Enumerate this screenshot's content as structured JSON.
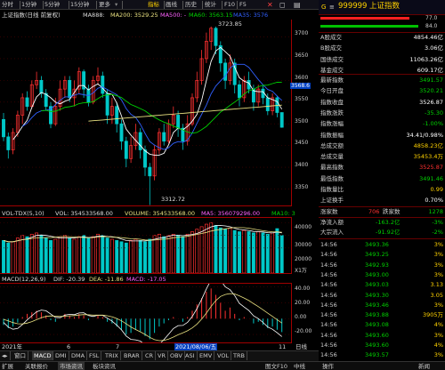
{
  "toolbar": {
    "items": [
      "分时",
      "1分钟",
      "5分钟",
      "15分钟",
      "更多",
      "指标",
      "画线",
      "历史",
      "统计",
      "F10",
      "F5"
    ],
    "selected_index": 5
  },
  "chart_header": {
    "title": "上证指数(日线 前复权)",
    "ma_label": "MA888:",
    "ma200": "MA200: 3529.25",
    "ma500": "MA500: -",
    "ma60": "MA60: 3563.15",
    "ma35": "MA35: 3576"
  },
  "price_axis": [
    "3700",
    "3650",
    "3600",
    "3550",
    "3500",
    "3450",
    "3400",
    "3350"
  ],
  "price_marker": "3568.6",
  "annot_high": "3723.85",
  "annot_low": "3312.72",
  "vol_header": {
    "name": "VOL-TDX(5,10)",
    "vol": "VOL: 354533568.00",
    "volume": "VOLUME: 354533568.00",
    "ma5": "MA5: 356079296.00",
    "ma10": "MA10: 3"
  },
  "vol_axis": [
    "40000",
    "30000",
    "20000"
  ],
  "vol_unit": "X1万",
  "macd_header": {
    "name": "MACD(12,26,9)",
    "dif": "DIF: -20.39",
    "dea": "DEA: -11.86",
    "macd": "MACD: -17.05"
  },
  "macd_axis": [
    "40.00",
    "20.00",
    "0.00",
    "-20.00"
  ],
  "date_axis": {
    "left": "2021年",
    "m6": "6",
    "m7": "7",
    "cursor_date": "2021/08/06/五",
    "m11": "11",
    "right": "日线"
  },
  "indicator_tabs": [
    "窗口",
    "MACD",
    "DMI",
    "DMA",
    "FSL",
    "TRIX",
    "BRAR",
    "CR",
    "VR",
    "OBV",
    "ASI",
    "EMV",
    "VOL",
    "TRB"
  ],
  "indicator_selected": 1,
  "bottom_bar": {
    "left_items": [
      "扩展",
      "关联报价",
      "市场资讯",
      "板块资讯"
    ],
    "right_items": [
      "图文F10",
      "中线",
      "操作",
      "新闻"
    ]
  },
  "quote_panel": {
    "code": "999999",
    "name": "上证指数",
    "mini_values": [
      "77.0",
      "84.0"
    ],
    "rows_a": [
      {
        "k": "A股成交",
        "v": "4854.46亿",
        "c": "white"
      },
      {
        "k": "B股成交",
        "v": "3.06亿",
        "c": "white"
      },
      {
        "k": "国债成交",
        "v": "11063.26亿",
        "c": "white"
      },
      {
        "k": "基金成交",
        "v": "609.17亿",
        "c": "white"
      }
    ],
    "rows_b": [
      {
        "k": "最新指数",
        "v": "3491.57",
        "c": "green"
      },
      {
        "k": "今日开盘",
        "v": "3520.21",
        "c": "green"
      },
      {
        "k": "指数收盘",
        "v": "3526.87",
        "c": "white"
      },
      {
        "k": "指数涨跌",
        "v": "-35.30",
        "c": "green"
      },
      {
        "k": "指数涨幅",
        "v": "-1.00%",
        "c": "green"
      },
      {
        "k": "指数振幅",
        "v": "34.41/0.98%",
        "c": "white"
      },
      {
        "k": "总成交额",
        "v": "4858.23亿",
        "c": "yellow"
      },
      {
        "k": "总成交量",
        "v": "35453.4万",
        "c": "yellow"
      },
      {
        "k": "最高指数",
        "v": "3525.87",
        "c": "red"
      },
      {
        "k": "最低指数",
        "v": "3491.46",
        "c": "green"
      },
      {
        "k": "指数量比",
        "v": "0.99",
        "c": "yellow"
      },
      {
        "k": "上证换手",
        "v": "0.70%",
        "c": "white"
      }
    ],
    "adv_decl": {
      "up_label": "涨家数",
      "up": "706",
      "down_label": "跌家数",
      "down": "1278"
    },
    "flows": [
      {
        "k": "净流入额",
        "v1": "-163.2亿",
        "v2": "-3%"
      },
      {
        "k": "大宗流入",
        "v1": "-91.92亿",
        "v2": "-2%"
      }
    ],
    "ticks": [
      {
        "t": "14:56",
        "p": "3493.36",
        "v": "3%"
      },
      {
        "t": "14:56",
        "p": "3493.25",
        "v": "3%"
      },
      {
        "t": "14:56",
        "p": "3492.93",
        "v": "3%"
      },
      {
        "t": "14:56",
        "p": "3493.00",
        "v": "3%"
      },
      {
        "t": "14:56",
        "p": "3493.03",
        "v": "3.13"
      },
      {
        "t": "14:56",
        "p": "3493.30",
        "v": "3.05"
      },
      {
        "t": "14:56",
        "p": "3493.46",
        "v": "3%"
      },
      {
        "t": "14:56",
        "p": "3493.88",
        "v": "3905万"
      },
      {
        "t": "14:56",
        "p": "3493.08",
        "v": "4%"
      },
      {
        "t": "14:56",
        "p": "3493.60",
        "v": "3%"
      },
      {
        "t": "14:56",
        "p": "3493.60",
        "v": "4%"
      },
      {
        "t": "14:56",
        "p": "3493.57",
        "v": "3%"
      }
    ]
  },
  "colors": {
    "up": "#ff3030",
    "down": "#00d000",
    "grid": "#a00000",
    "ma_white": "#ffffff",
    "ma_yellow": "#e8e080",
    "ma_blue": "#3060ff"
  },
  "candles": [
    [
      3510,
      3470,
      3525,
      3460
    ],
    [
      3470,
      3440,
      3480,
      3420
    ],
    [
      3440,
      3480,
      3490,
      3430
    ],
    [
      3480,
      3520,
      3530,
      3470
    ],
    [
      3520,
      3560,
      3570,
      3500
    ],
    [
      3560,
      3540,
      3575,
      3530
    ],
    [
      3540,
      3590,
      3600,
      3535
    ],
    [
      3590,
      3600,
      3620,
      3580
    ],
    [
      3600,
      3570,
      3610,
      3560
    ],
    [
      3570,
      3540,
      3580,
      3530
    ],
    [
      3540,
      3500,
      3550,
      3490
    ],
    [
      3500,
      3540,
      3560,
      3495
    ],
    [
      3540,
      3580,
      3600,
      3530
    ],
    [
      3580,
      3600,
      3610,
      3560
    ],
    [
      3600,
      3560,
      3610,
      3550
    ],
    [
      3560,
      3580,
      3600,
      3540
    ],
    [
      3580,
      3620,
      3630,
      3570
    ],
    [
      3620,
      3580,
      3625,
      3560
    ],
    [
      3580,
      3550,
      3590,
      3540
    ],
    [
      3550,
      3600,
      3610,
      3545
    ],
    [
      3600,
      3610,
      3630,
      3590
    ],
    [
      3610,
      3570,
      3620,
      3560
    ],
    [
      3570,
      3520,
      3580,
      3500
    ],
    [
      3520,
      3540,
      3560,
      3500
    ],
    [
      3540,
      3500,
      3550,
      3480
    ],
    [
      3500,
      3460,
      3510,
      3440
    ],
    [
      3460,
      3420,
      3470,
      3400
    ],
    [
      3420,
      3450,
      3470,
      3410
    ],
    [
      3450,
      3480,
      3500,
      3440
    ],
    [
      3480,
      3440,
      3490,
      3420
    ],
    [
      3440,
      3400,
      3450,
      3380
    ],
    [
      3400,
      3380,
      3410,
      3313
    ],
    [
      3380,
      3440,
      3450,
      3370
    ],
    [
      3440,
      3480,
      3490,
      3430
    ],
    [
      3480,
      3460,
      3500,
      3450
    ],
    [
      3460,
      3500,
      3510,
      3455
    ],
    [
      3500,
      3520,
      3540,
      3490
    ],
    [
      3520,
      3490,
      3530,
      3470
    ],
    [
      3490,
      3460,
      3500,
      3440
    ],
    [
      3460,
      3500,
      3520,
      3450
    ],
    [
      3500,
      3560,
      3570,
      3495
    ],
    [
      3560,
      3600,
      3620,
      3550
    ],
    [
      3600,
      3650,
      3670,
      3590
    ],
    [
      3650,
      3690,
      3710,
      3640
    ],
    [
      3690,
      3720,
      3724,
      3670
    ],
    [
      3720,
      3680,
      3724,
      3660
    ],
    [
      3680,
      3640,
      3690,
      3620
    ],
    [
      3640,
      3600,
      3650,
      3580
    ],
    [
      3600,
      3640,
      3660,
      3590
    ],
    [
      3640,
      3590,
      3650,
      3570
    ],
    [
      3590,
      3560,
      3600,
      3540
    ],
    [
      3560,
      3600,
      3610,
      3550
    ],
    [
      3600,
      3580,
      3620,
      3570
    ],
    [
      3580,
      3550,
      3590,
      3530
    ],
    [
      3550,
      3580,
      3590,
      3540
    ],
    [
      3580,
      3560,
      3590,
      3545
    ],
    [
      3560,
      3530,
      3570,
      3520
    ],
    [
      3530,
      3560,
      3570,
      3520
    ],
    [
      3560,
      3526,
      3565,
      3515
    ],
    [
      3526,
      3492,
      3526,
      3491
    ]
  ],
  "volumes": [
    26000,
    24000,
    25000,
    28000,
    30000,
    29000,
    31000,
    32000,
    30000,
    28000,
    26000,
    27000,
    29000,
    30000,
    28000,
    27000,
    29000,
    30000,
    28000,
    29000,
    31000,
    30000,
    28000,
    27000,
    26000,
    25000,
    24000,
    26000,
    27000,
    26000,
    25000,
    27000,
    30000,
    31000,
    29000,
    30000,
    31000,
    30000,
    29000,
    31000,
    33000,
    35000,
    37000,
    39000,
    40000,
    38000,
    36000,
    35000,
    36000,
    34000,
    33000,
    34000,
    33000,
    32000,
    33000,
    32000,
    31000,
    32000,
    35453,
    30000
  ],
  "macd_hist": [
    -8,
    -12,
    -10,
    -5,
    2,
    6,
    8,
    10,
    8,
    4,
    -2,
    -4,
    0,
    6,
    4,
    2,
    6,
    4,
    -2,
    0,
    4,
    2,
    -4,
    -6,
    -10,
    -14,
    -20,
    -18,
    -14,
    -16,
    -22,
    -26,
    -18,
    -10,
    -6,
    -2,
    2,
    0,
    -4,
    2,
    10,
    18,
    26,
    34,
    38,
    30,
    20,
    10,
    14,
    6,
    -2,
    2,
    0,
    -6,
    -4,
    -8,
    -12,
    -10,
    -14,
    -17
  ]
}
